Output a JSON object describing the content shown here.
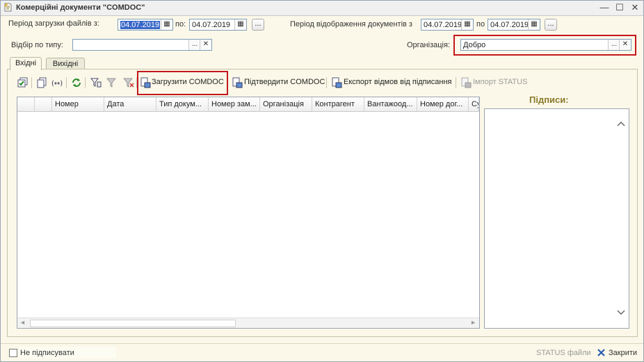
{
  "window": {
    "title": "Комерційні документи \"COMDOC\"",
    "controls": {
      "minimize": "—",
      "maximize": "☐",
      "close": "✕"
    }
  },
  "filters": {
    "load_period_label": "Період загрузки файлів з:",
    "load_from": "04.07.2019",
    "load_to_label": "по:",
    "load_to": "04.07.2019",
    "display_period_label": "Період відображення документів з",
    "display_from": "04.07.2019",
    "display_to_label": "по",
    "display_to": "04.07.2019",
    "type_filter_label": "Відбір по типу:",
    "type_filter_value": "",
    "org_label": "Організація:",
    "org_value": "Добро",
    "dots": "...",
    "clear": "✕"
  },
  "tabs": [
    {
      "label": "Вхідні",
      "active": true
    },
    {
      "label": "Вихідні",
      "active": false
    }
  ],
  "toolbar": {
    "load_comdoc": "Загрузити COMDOC",
    "confirm_comdoc": "Підтвердити COMDOC",
    "export_refusals": "Експорт відмов від підписання",
    "import_status": "Імпорт STATUS"
  },
  "table": {
    "columns": [
      "Номер",
      "Дата",
      "Тип докум...",
      "Номер зам...",
      "Організація",
      "Контрагент",
      "Вантажоод...",
      "Номер дог...",
      "Су"
    ],
    "rows": []
  },
  "signatures": {
    "title": "Підписи:"
  },
  "footer": {
    "no_sign_label": "Не підписувати",
    "status_files": "STATUS файли",
    "close_label": "Закрити"
  },
  "colors": {
    "highlight_red": "#c4161c",
    "background": "#fbf8e9",
    "signatures_title": "#8a7a2a",
    "selection": "#3867c7"
  }
}
